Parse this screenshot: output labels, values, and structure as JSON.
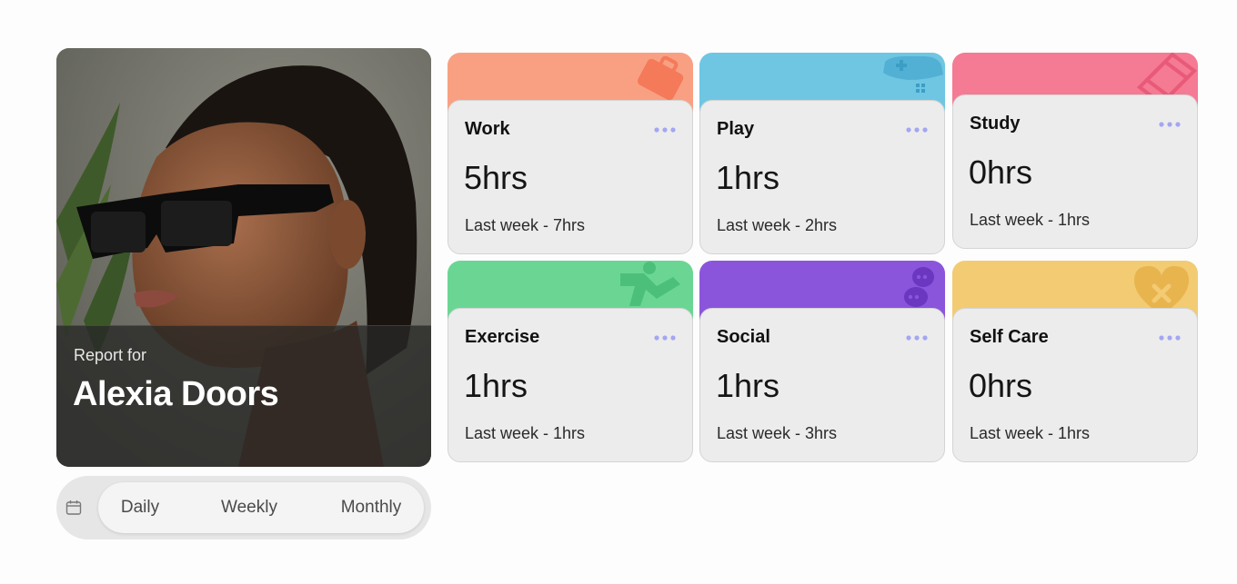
{
  "profile": {
    "report_label": "Report for",
    "name": "Alexia Doors"
  },
  "period": {
    "icon": "calendar-icon",
    "options": [
      "Daily",
      "Weekly",
      "Monthly"
    ]
  },
  "activities": [
    {
      "category": "Work",
      "current": "5hrs",
      "previous": "Last week - 7hrs",
      "color": "#f9a083",
      "icon": "briefcase-icon"
    },
    {
      "category": "Play",
      "current": "1hrs",
      "previous": "Last week - 2hrs",
      "color": "#6fc6e3",
      "icon": "gamepad-icon"
    },
    {
      "category": "Study",
      "current": "0hrs",
      "previous": "Last week - 1hrs",
      "color": "#f57a93",
      "icon": "books-icon"
    },
    {
      "category": "Exercise",
      "current": "1hrs",
      "previous": "Last week - 1hrs",
      "color": "#6bd694",
      "icon": "running-icon"
    },
    {
      "category": "Social",
      "current": "1hrs",
      "previous": "Last week - 3hrs",
      "color": "#8a55db",
      "icon": "chat-bubbles-icon"
    },
    {
      "category": "Self Care",
      "current": "0hrs",
      "previous": "Last week - 1hrs",
      "color": "#f2cb73",
      "icon": "heart-bandage-icon"
    }
  ],
  "colors": {
    "dots": "#a4a6f3",
    "card_body": "#ececec"
  }
}
